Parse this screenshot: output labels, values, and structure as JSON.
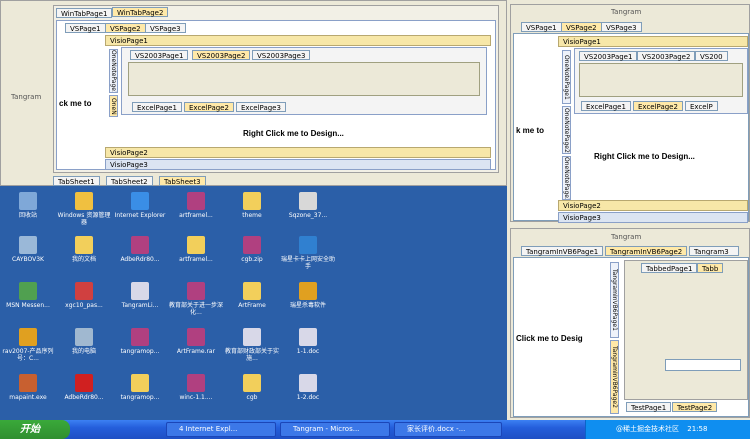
{
  "left_panel": {
    "tangram_label": "Tangram",
    "wintabs": [
      "WinTabPage1",
      "WinTabPage2"
    ],
    "left_text": "ck me to",
    "vs_tabs": [
      "VSPage1",
      "VSPage2",
      "VSPage3"
    ],
    "visio_pages": [
      "VisioPage1",
      "VisioPage2",
      "VisioPage3"
    ],
    "onenote_tabs": [
      "OneNotePage1",
      "OneN"
    ],
    "vs2003_tabs": [
      "VS2003Page1",
      "VS2003Page2",
      "VS2003Page3"
    ],
    "excel_tabs": [
      "ExcelPage1",
      "ExcelPage2",
      "ExcelPage3"
    ],
    "design_text": "Right Click me to Design...",
    "sheet_tabs": [
      "TabSheet1",
      "TabSheet2",
      "TabSheet3"
    ]
  },
  "right_top": {
    "tangram_label": "Tangram",
    "vs_tabs": [
      "VSPage1",
      "VSPage2",
      "VSPage3"
    ],
    "visio_pages": [
      "VisioPage1",
      "VisioPage2",
      "VisioPage3"
    ],
    "onenote_tabs": [
      "OneNotePage1",
      "OneNotePage2",
      "OneNotePage3"
    ],
    "vs2003_tabs": [
      "VS2003Page1",
      "VS2003Page2",
      "VS200"
    ],
    "excel_tabs": [
      "ExcelPage1",
      "ExcelPage2",
      "ExcelP"
    ],
    "left_text": "k me to",
    "design_text": "Right Click me to Design..."
  },
  "right_bottom": {
    "tangram_label": "Tangram",
    "vb_tabs": [
      "TangramInVB6Page1",
      "TangramInVB6Page2",
      "Tangram3"
    ],
    "left_text": "Click me to Desig",
    "vtabs": [
      "TangramInVB6Page1",
      "TangramInVB6Page2"
    ],
    "tabbed": [
      "TabbedPage1",
      "Tabb"
    ],
    "test_tabs": [
      "TestPage1",
      "TestPage2"
    ]
  },
  "desktop": {
    "icons": [
      {
        "label": "回收站",
        "color": "#7fa8d8"
      },
      {
        "label": "Windows 资源管理器",
        "color": "#f0c040"
      },
      {
        "label": "Internet Explorer",
        "color": "#3a8ee6"
      },
      {
        "label": "artframel...",
        "color": "#b04080"
      },
      {
        "label": "theme",
        "color": "#f2cf5b"
      },
      {
        "label": "Sqzone_37...",
        "color": "#d8d8d8"
      },
      {
        "label": "CAYBOV3K",
        "color": "#9ab8d8"
      },
      {
        "label": "我的文档",
        "color": "#f2cf5b"
      },
      {
        "label": "AdbeRdr80...",
        "color": "#b04080"
      },
      {
        "label": "artframel...",
        "color": "#f2cf5b"
      },
      {
        "label": "cgb.zip",
        "color": "#b04080"
      },
      {
        "label": "瑞星卡卡上网安全助手",
        "color": "#3080d0"
      },
      {
        "label": "MSN Messen...",
        "color": "#50a050"
      },
      {
        "label": "xgc10_pas...",
        "color": "#d04040"
      },
      {
        "label": "TangramLi...",
        "color": "#d8d8e8"
      },
      {
        "label": "教育部关于进一步深化...",
        "color": "#b04080"
      },
      {
        "label": "ArtFrame",
        "color": "#f2cf5b"
      },
      {
        "label": "瑞星杀毒软件",
        "color": "#e0a020"
      },
      {
        "label": "rav2007-产品序列号：C...",
        "color": "#e0a020"
      },
      {
        "label": "我的电脑",
        "color": "#a0b8d0"
      },
      {
        "label": "tangramop...",
        "color": "#b04080"
      },
      {
        "label": "ArtFrame.rar",
        "color": "#b04080"
      },
      {
        "label": "教育部财政部关于实施...",
        "color": "#d8d8e8"
      },
      {
        "label": "1-1.doc",
        "color": "#d8d8e8"
      },
      {
        "label": "mapaint.exe",
        "color": "#c86030"
      },
      {
        "label": "AdbeRdr80...",
        "color": "#d02020"
      },
      {
        "label": "tangramop...",
        "color": "#f2cf5b"
      },
      {
        "label": "winc-1.1....",
        "color": "#b04080"
      },
      {
        "label": "cgb",
        "color": "#f2cf5b"
      },
      {
        "label": "1-2.doc",
        "color": "#d8d8e8"
      }
    ]
  },
  "taskbar": {
    "start_label": "开始",
    "tasks": [
      "4 Internet Expl...",
      "Tangram - Micros...",
      "家长评价.docx -..."
    ],
    "tray_text": "@稀土掘金技术社区",
    "clock": "21:58"
  }
}
